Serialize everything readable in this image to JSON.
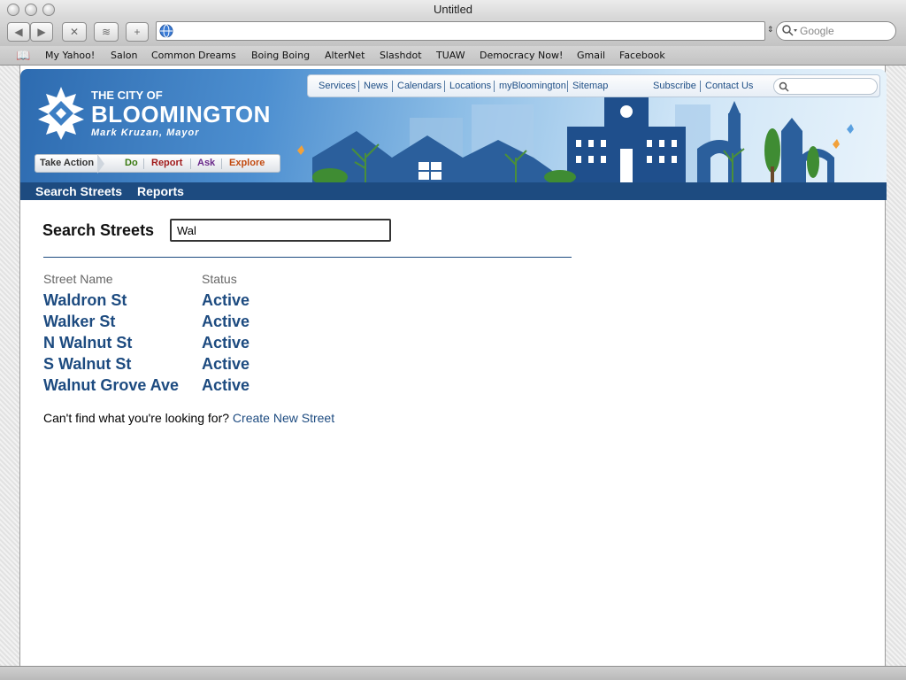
{
  "window": {
    "title": "Untitled"
  },
  "toolbar": {
    "url": "",
    "search_placeholder": "Google"
  },
  "bookmarks": [
    "My Yahoo!",
    "Salon",
    "Common Dreams",
    "Boing Boing",
    "AlterNet",
    "Slashdot",
    "TUAW",
    "Democracy Now!",
    "Gmail",
    "Facebook"
  ],
  "site": {
    "city_line": "THE CITY OF",
    "city_name": "BLOOMINGTON",
    "mayor": "Mark Kruzan, Mayor",
    "top_links": [
      "Services",
      "News",
      "Calendars",
      "Locations",
      "myBloomington",
      "Sitemap",
      "Subscribe",
      "Contact Us"
    ],
    "take_action": {
      "label": "Take Action",
      "items": [
        "Do",
        "Report",
        "Ask",
        "Explore"
      ],
      "colors": [
        "#3a7a12",
        "#a01a1a",
        "#6a2a8a",
        "#c24a10"
      ]
    },
    "subnav": [
      "Search Streets",
      "Reports"
    ]
  },
  "main": {
    "title": "Search Streets",
    "search_value": "Wal",
    "columns": [
      "Street Name",
      "Status"
    ],
    "rows": [
      {
        "name": "Waldron St",
        "status": "Active"
      },
      {
        "name": "Walker St",
        "status": "Active"
      },
      {
        "name": "N Walnut St",
        "status": "Active"
      },
      {
        "name": "S Walnut St",
        "status": "Active"
      },
      {
        "name": "Walnut Grove Ave",
        "status": "Active"
      }
    ],
    "help_text": "Can't find what you're looking for?",
    "create_link": "Create New Street"
  },
  "colors": {
    "brand_dark": "#1d4b80",
    "brand_light": "#4d8fd0"
  }
}
